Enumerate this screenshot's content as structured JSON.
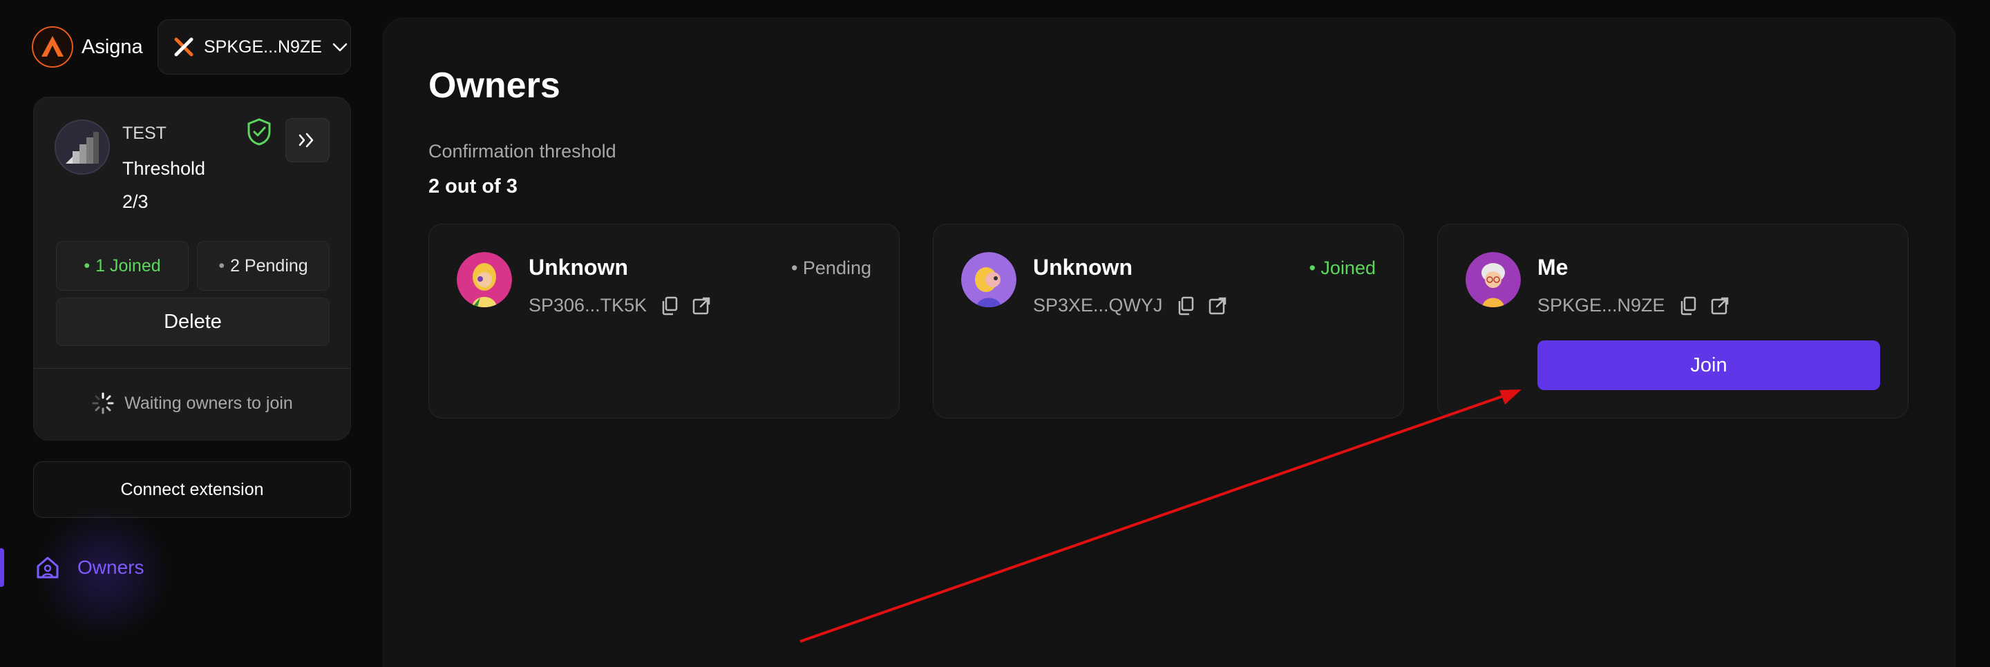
{
  "brand": {
    "name": "Asigna"
  },
  "wallet": {
    "address": "SPKGE...N9ZE"
  },
  "vault": {
    "name": "TEST",
    "threshold_label": "Threshold",
    "threshold_value": "2/3",
    "joined_label": "1 Joined",
    "pending_label": "2 Pending",
    "delete_label": "Delete",
    "waiting_label": "Waiting owners to join",
    "status_color": "#5cd65c"
  },
  "sidebar": {
    "connect_label": "Connect extension",
    "nav": [
      {
        "label": "Owners",
        "icon": "home-icon",
        "active": true
      }
    ]
  },
  "main": {
    "title": "Owners",
    "confirmation_label": "Confirmation threshold",
    "confirmation_value": "2 out of 3",
    "owners": [
      {
        "name": "Unknown",
        "status": "Pending",
        "address": "SP306...TK5K"
      },
      {
        "name": "Unknown",
        "status": "Joined",
        "address": "SP3XE...QWYJ"
      },
      {
        "name": "Me",
        "status": "",
        "address": "SPKGE...N9ZE",
        "action": "Join"
      }
    ]
  },
  "colors": {
    "accent": "#6036e8",
    "joined": "#5cd65c",
    "annotation": "#e01010"
  }
}
